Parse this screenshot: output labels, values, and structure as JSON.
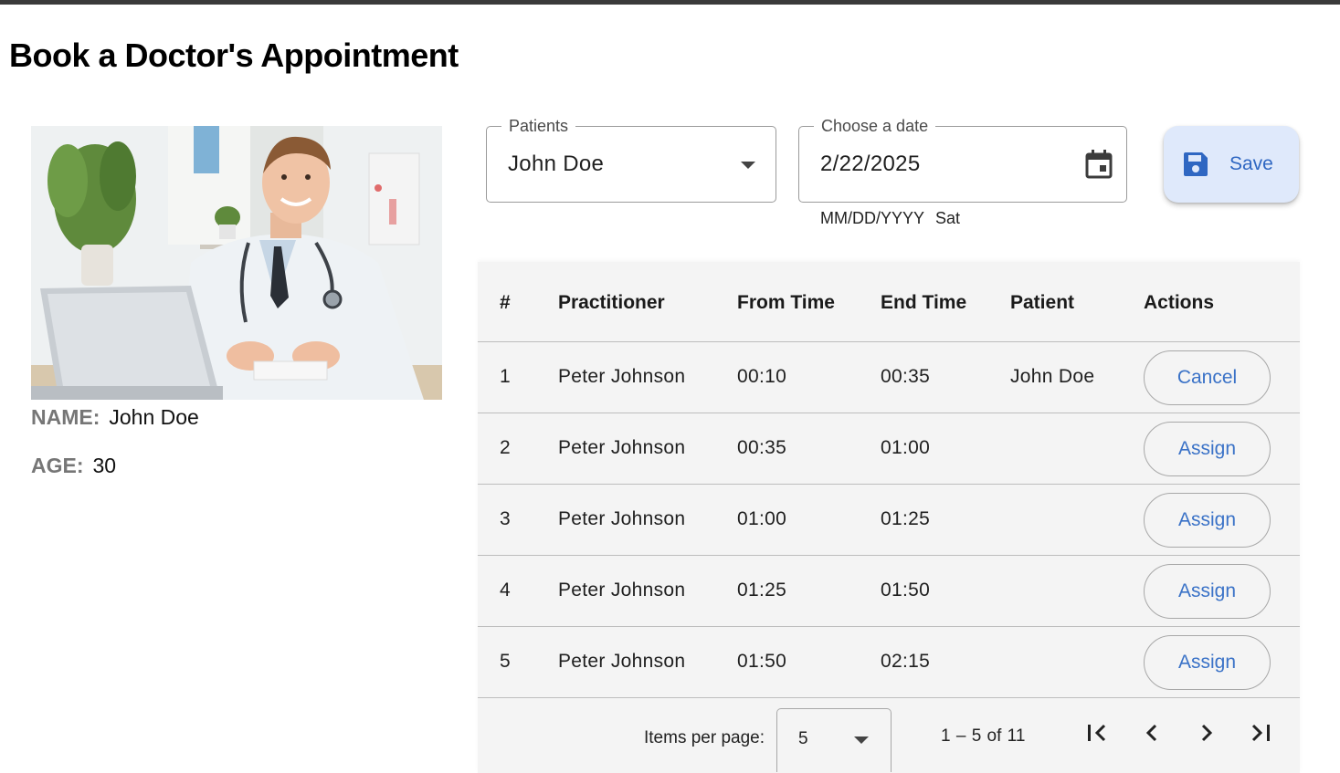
{
  "page": {
    "title": "Book a Doctor's Appointment"
  },
  "profile": {
    "image_alt": "doctor-photo",
    "name_label": "NAME:",
    "name_value": "John Doe",
    "age_label": "AGE:",
    "age_value": "30"
  },
  "form": {
    "patients": {
      "label": "Patients",
      "value": "John Doe"
    },
    "date": {
      "label": "Choose a date",
      "value": "2/22/2025",
      "format_hint": "MM/DD/YYYY",
      "weekday": "Sat"
    },
    "save_label": "Save"
  },
  "table": {
    "headers": [
      "#",
      "Practitioner",
      "From Time",
      "End Time",
      "Patient",
      "Actions"
    ],
    "rows": [
      {
        "num": "1",
        "practitioner": "Peter Johnson",
        "from": "00:10",
        "end": "00:35",
        "patient": "John Doe",
        "action": "Cancel"
      },
      {
        "num": "2",
        "practitioner": "Peter Johnson",
        "from": "00:35",
        "end": "01:00",
        "patient": "",
        "action": "Assign"
      },
      {
        "num": "3",
        "practitioner": "Peter Johnson",
        "from": "01:00",
        "end": "01:25",
        "patient": "",
        "action": "Assign"
      },
      {
        "num": "4",
        "practitioner": "Peter Johnson",
        "from": "01:25",
        "end": "01:50",
        "patient": "",
        "action": "Assign"
      },
      {
        "num": "5",
        "practitioner": "Peter Johnson",
        "from": "01:50",
        "end": "02:15",
        "patient": "",
        "action": "Assign"
      }
    ]
  },
  "paginator": {
    "items_per_page_label": "Items per page:",
    "items_per_page_value": "5",
    "range_label": "1 – 5 of 11"
  },
  "colors": {
    "accent": "#3a72c7",
    "save_bg": "#dfe9fb",
    "table_bg": "#f4f4f4"
  }
}
